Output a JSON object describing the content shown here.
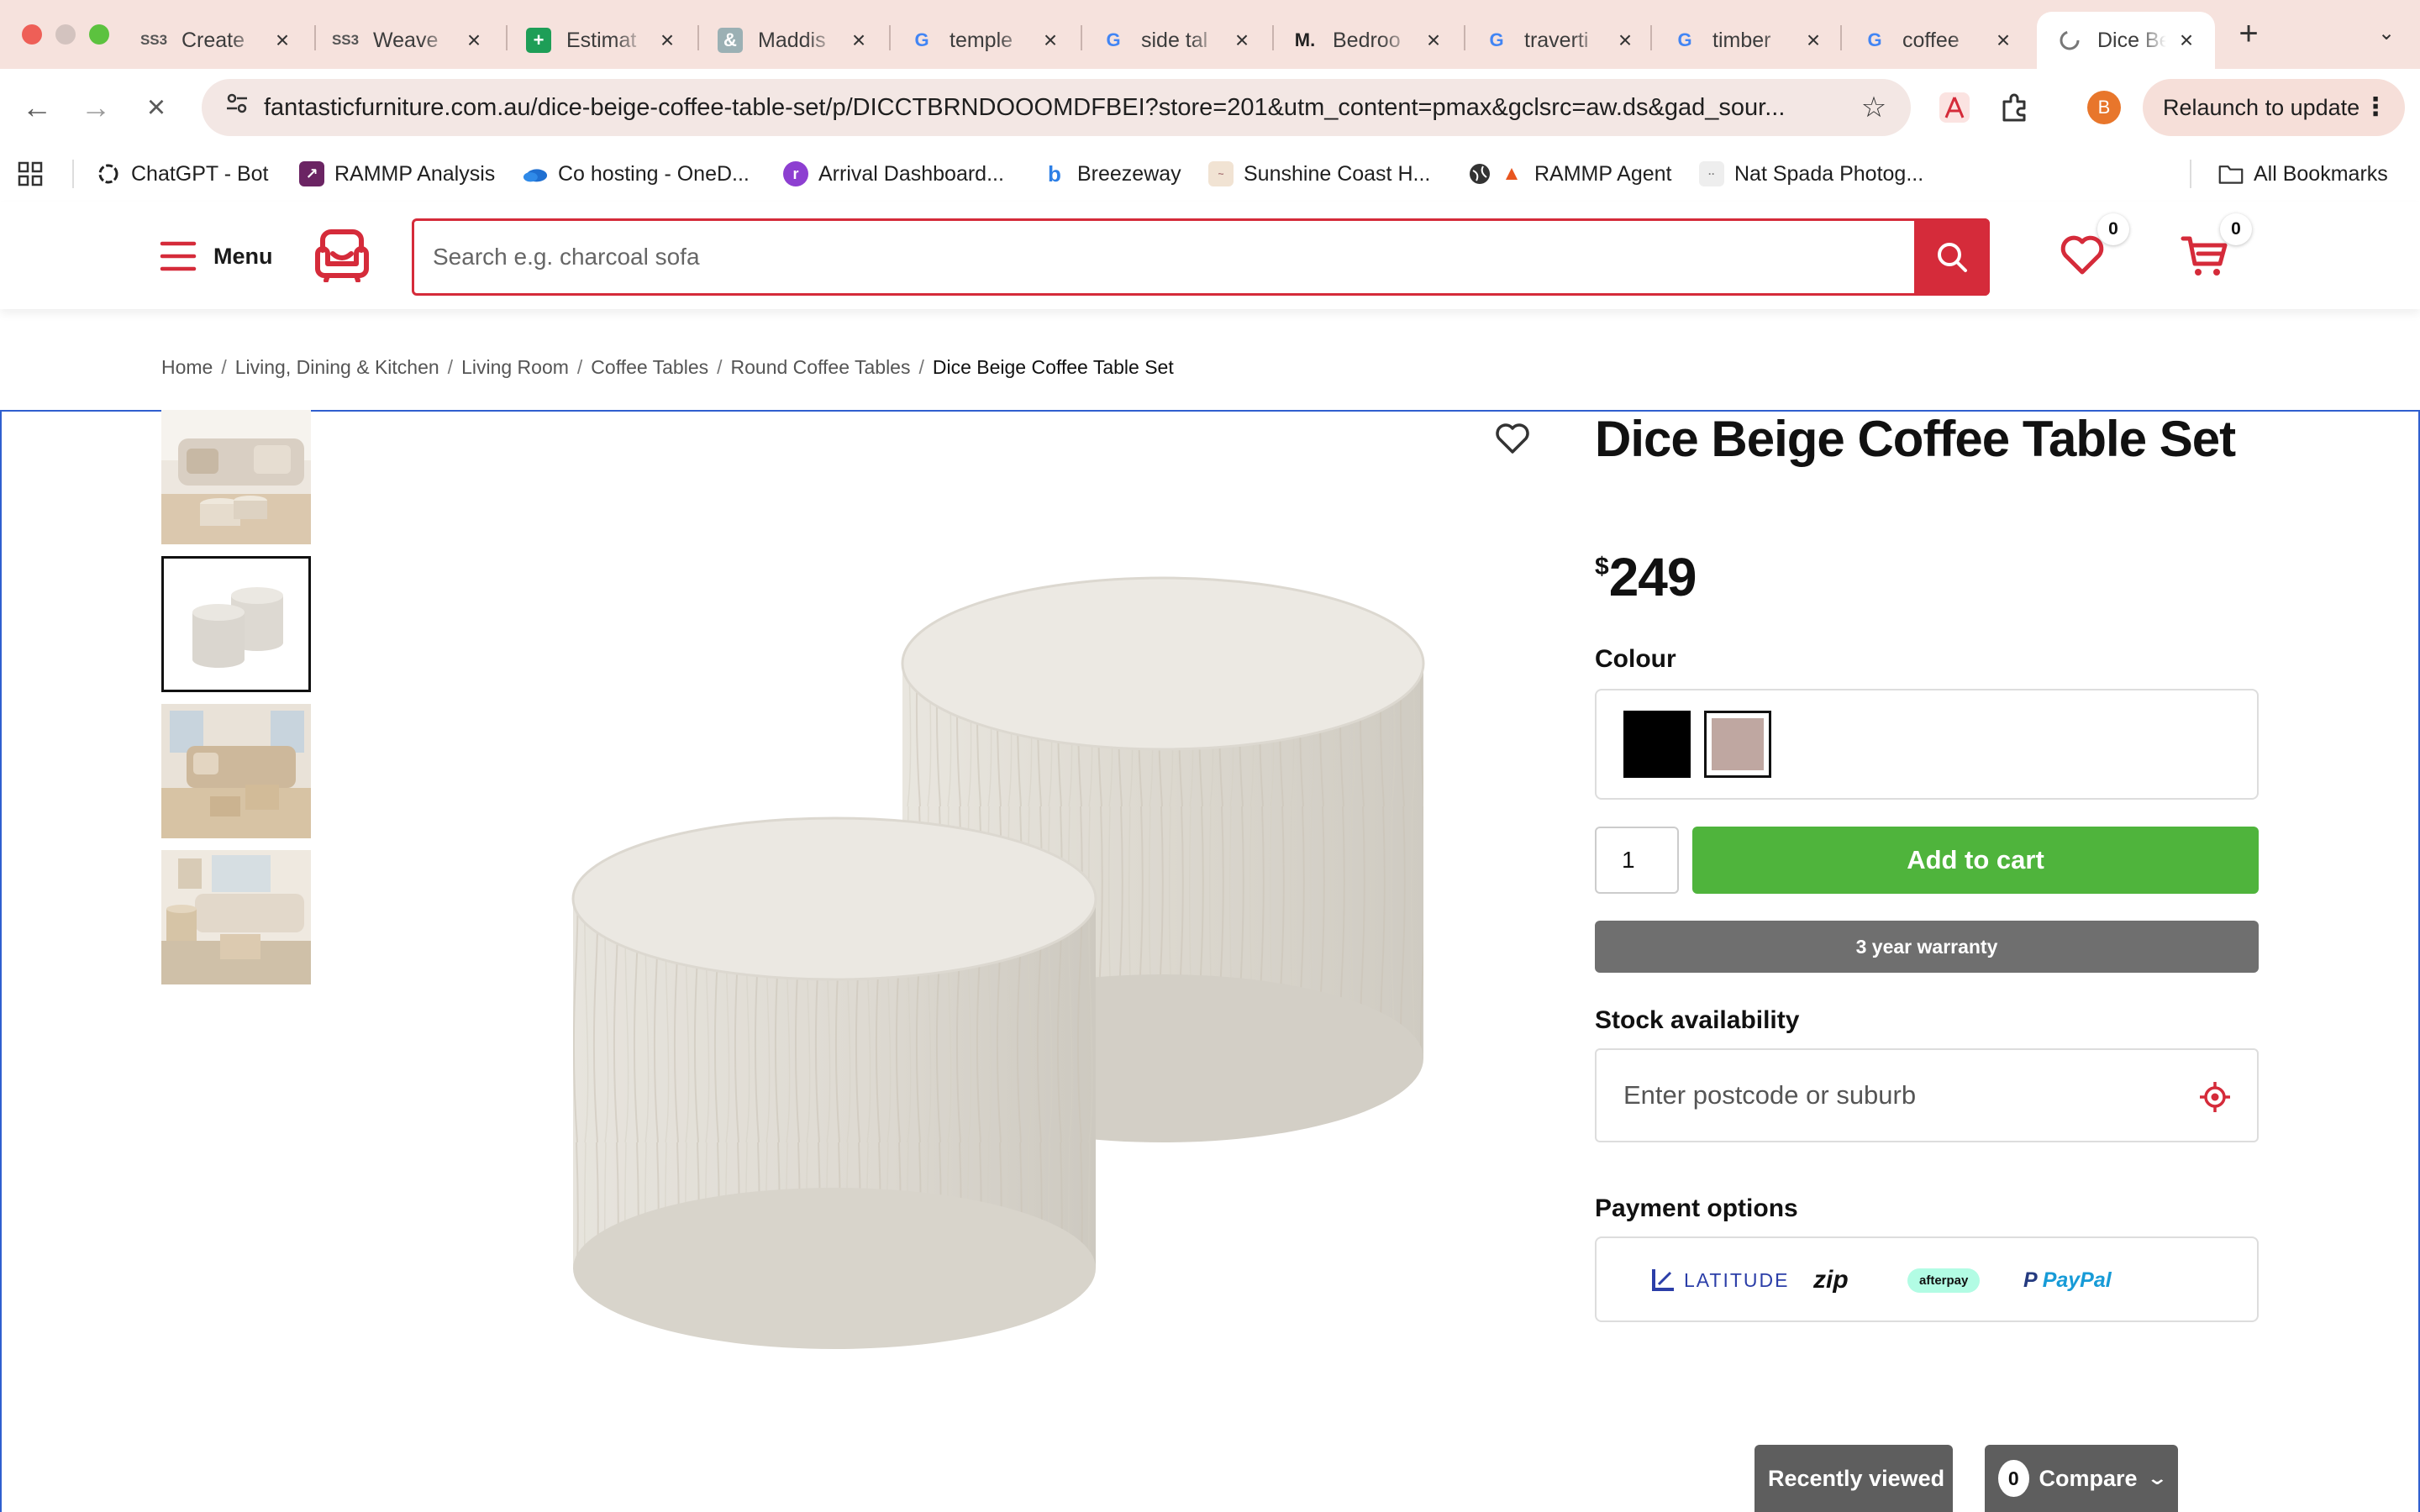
{
  "browser": {
    "tabs": [
      {
        "title": "Create",
        "favicon": "ss3-icon"
      },
      {
        "title": "Weave",
        "favicon": "ss3-icon"
      },
      {
        "title": "Estimat",
        "favicon": "sheets-icon"
      },
      {
        "title": "Maddis",
        "favicon": "ampersand-icon"
      },
      {
        "title": "temple",
        "favicon": "google-icon"
      },
      {
        "title": "side tal",
        "favicon": "google-icon"
      },
      {
        "title": "Bedroo",
        "favicon": "m-icon"
      },
      {
        "title": "traverti",
        "favicon": "google-icon"
      },
      {
        "title": "timber",
        "favicon": "google-icon"
      },
      {
        "title": "coffee",
        "favicon": "google-icon"
      },
      {
        "title": "Dice Be",
        "favicon": "loading-icon",
        "active": true
      }
    ],
    "url": "fantasticfurniture.com.au/dice-beige-coffee-table-set/p/DICCTBRNDOOOMDFBEI?store=201&utm_content=pmax&gclsrc=aw.ds&gad_sour...",
    "profile_initial": "B",
    "relaunch_label": "Relaunch to update",
    "bookmarks": [
      {
        "label": "ChatGPT - Bot",
        "icon": "chatgpt-icon"
      },
      {
        "label": "RAMMP Analysis",
        "icon": "rammp-icon"
      },
      {
        "label": "Co hosting - OneD...",
        "icon": "onedrive-icon"
      },
      {
        "label": "Arrival Dashboard...",
        "icon": "arrival-icon"
      },
      {
        "label": "Breezeway",
        "icon": "breezeway-icon"
      },
      {
        "label": "Sunshine Coast H...",
        "icon": "sunshine-icon"
      },
      {
        "label": "RAMMP Agent",
        "icon": "fire-icon"
      },
      {
        "label": "Nat Spada Photog...",
        "icon": "photo-icon"
      }
    ],
    "all_bookmarks_label": "All Bookmarks",
    "colors": {
      "tabstrip": "#f6e2dd",
      "omnibox": "#f3e7e4"
    }
  },
  "site": {
    "menu_label": "Menu",
    "search_placeholder": "Search e.g. charcoal sofa",
    "wishlist_count": "0",
    "cart_count": "0",
    "brand_color": "#d52b3a"
  },
  "breadcrumb": [
    "Home",
    "Living, Dining & Kitchen",
    "Living Room",
    "Coffee Tables",
    "Round Coffee Tables",
    "Dice Beige Coffee Table Set"
  ],
  "product": {
    "title": "Dice Beige Coffee Table Set",
    "currency_symbol": "$",
    "price": "249",
    "colour_label": "Colour",
    "swatches": [
      {
        "name": "black",
        "color": "#000000"
      },
      {
        "name": "beige",
        "color": "#bfa7a1",
        "selected": true
      }
    ],
    "quantity": "1",
    "add_to_cart_label": "Add to cart",
    "warranty_label": "3 year warranty",
    "stock_label": "Stock availability",
    "postcode_placeholder": "Enter postcode or suburb",
    "payment_label": "Payment options",
    "payment_methods": [
      "LATITUDE",
      "zip",
      "afterpay",
      "PayPal"
    ],
    "add_to_cart_color": "#4fb43c",
    "thumbnails": [
      "room-scene-1",
      "tables-white-bg",
      "room-scene-2",
      "room-scene-3"
    ],
    "selected_thumbnail": 1
  },
  "floating": {
    "recently_viewed_label": "Recently viewed",
    "compare_label": "Compare",
    "compare_count": "0"
  }
}
